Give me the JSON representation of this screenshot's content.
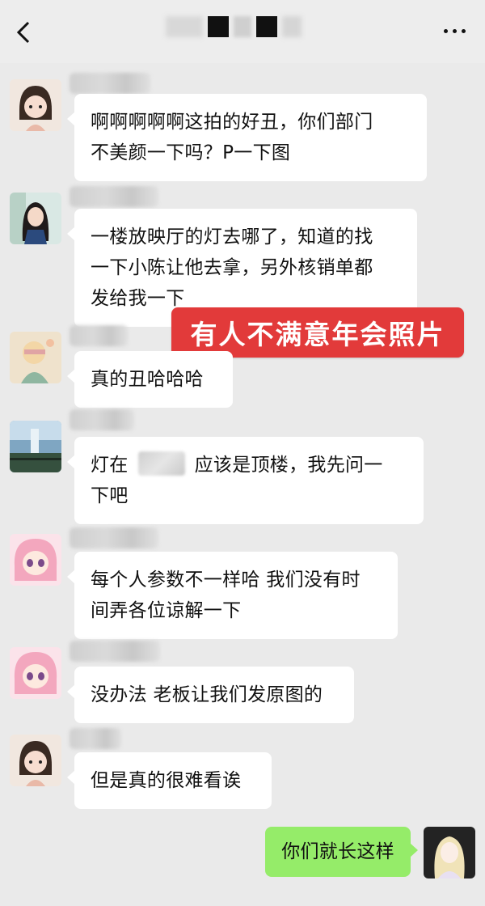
{
  "header": {
    "back_icon": "chevron-left-icon",
    "more_icon": "more-dots-icon"
  },
  "overlay_caption": "有人不满意年会照片",
  "messages": [
    {
      "text": "啊啊啊啊啊这拍的好丑，你们部门不美颜一下吗？P一下图",
      "line1": "啊啊啊啊啊这拍的好丑，你们部门",
      "line2": "不美颜一下吗？P一下图"
    },
    {
      "line1": "一楼放映厅的灯去哪了，知道的找",
      "line2": "一下小陈让他去拿，另外核销单都",
      "line3": "发给我一下"
    },
    {
      "line1": "真的丑哈哈哈"
    },
    {
      "part_a": "灯在",
      "part_b": "应该是顶楼，我先问一",
      "line2": "下吧"
    },
    {
      "line1": "每个人参数不一样哈 我们没有时",
      "line2": "间弄各位谅解一下"
    },
    {
      "line1": "没办法 老板让我们发原图的"
    },
    {
      "line1": "但是真的很难看诶"
    }
  ],
  "my_message": "你们就长这样"
}
